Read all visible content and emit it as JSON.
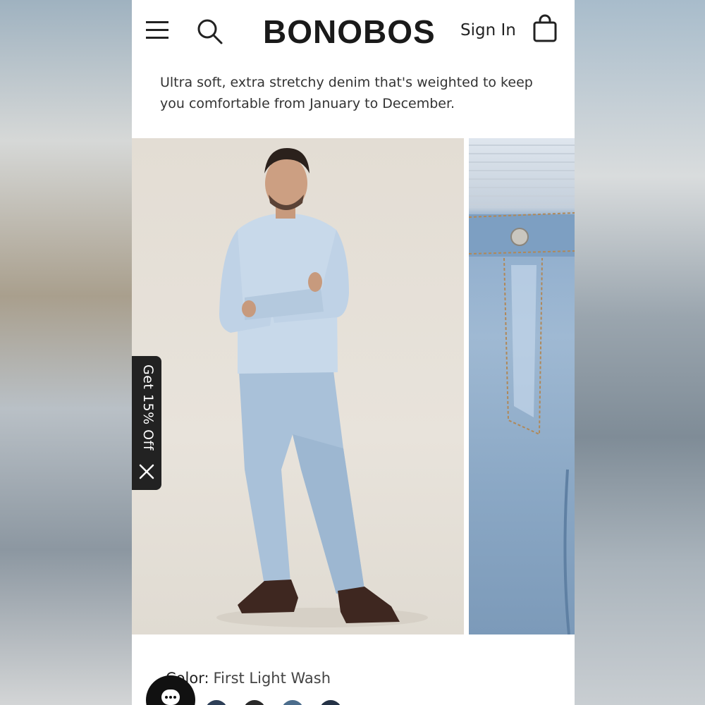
{
  "header": {
    "logo": "BONOBOS",
    "sign_in_label": "Sign In",
    "menu_icon": "hamburger-menu-icon",
    "search_icon": "search-icon",
    "bag_icon": "shopping-bag-icon"
  },
  "product": {
    "description": "Ultra soft, extra stretchy denim that's weighted to keep you comfortable from January to December.",
    "color_label": "Color:",
    "color_value": "First Light Wash"
  },
  "promo": {
    "label": "Get 15% Off",
    "close_icon": "close-icon"
  },
  "chat": {
    "icon": "chat-icon"
  },
  "colors": {
    "text": "#222222",
    "promo_bg": "#222222",
    "swatches": [
      "#2e3f57",
      "#2a2a2a",
      "#4c6d8c",
      "#253246"
    ]
  }
}
